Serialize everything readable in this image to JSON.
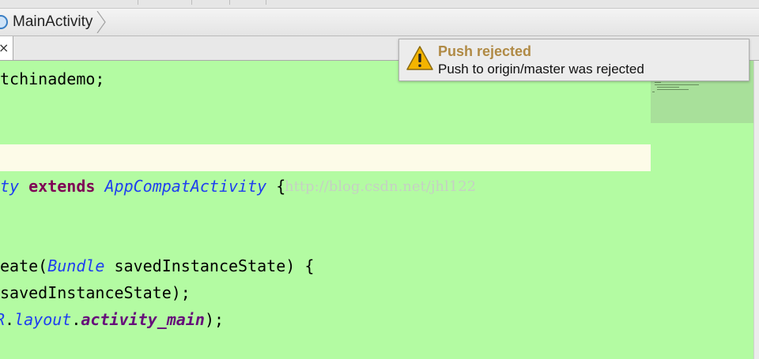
{
  "breadcrumb": {
    "label": "MainActivity"
  },
  "tab": {
    "close_glyph": "×"
  },
  "notification": {
    "title": "Push rejected",
    "message": "Push to origin/master was rejected",
    "icon": "warning-icon",
    "title_color": "#b08a45"
  },
  "watermark": "http://blog.csdn.net/jhl122",
  "code": {
    "line1": {
      "text": "tchinademo;"
    },
    "line2": {
      "t1": "ty",
      "kw": "extends",
      "cls": "AppCompatActivity",
      "t2": " {"
    },
    "line3": {
      "t1": "eate(",
      "cls": "Bundle",
      "t2": " savedInstanceState) {"
    },
    "line4": {
      "text": "savedInstanceState);"
    },
    "line5": {
      "rcls": "R",
      "t1": ".",
      "layout": "layout",
      "t2": ".",
      "fld": "activity_main",
      "t3": ");"
    }
  },
  "colors": {
    "editor_bg": "#b3fba2",
    "current_line": "#fdfbe8",
    "keyword": "#7f0055",
    "class": "#1e3ef0",
    "field": "#660e7a"
  }
}
